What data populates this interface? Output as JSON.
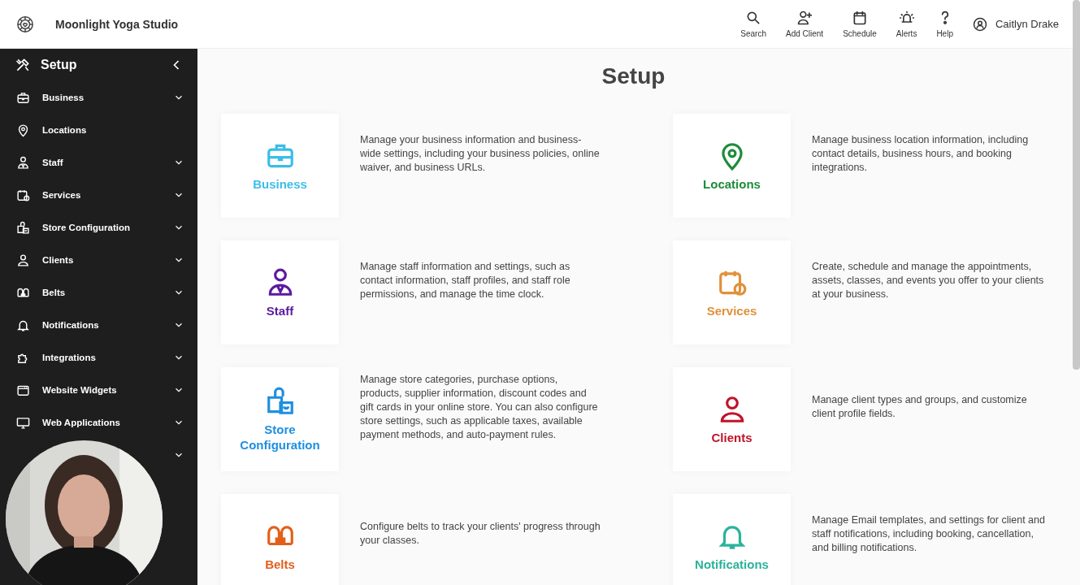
{
  "header": {
    "studio_name": "Moonlight Yoga Studio",
    "actions": [
      {
        "label": "Search"
      },
      {
        "label": "Add Client"
      },
      {
        "label": "Schedule"
      },
      {
        "label": "Alerts"
      },
      {
        "label": "Help"
      }
    ],
    "user_name": "Caitlyn Drake"
  },
  "sidebar": {
    "title": "Setup",
    "items": [
      {
        "label": "Business",
        "expandable": true
      },
      {
        "label": "Locations",
        "expandable": false
      },
      {
        "label": "Staff",
        "expandable": true
      },
      {
        "label": "Services",
        "expandable": true
      },
      {
        "label": "Store Configuration",
        "expandable": true
      },
      {
        "label": "Clients",
        "expandable": true
      },
      {
        "label": "Belts",
        "expandable": true
      },
      {
        "label": "Notifications",
        "expandable": true
      },
      {
        "label": "Integrations",
        "expandable": true
      },
      {
        "label": "Website Widgets",
        "expandable": true
      },
      {
        "label": "Web Applications",
        "expandable": true
      },
      {
        "expandable": true
      }
    ]
  },
  "page_title": "Setup",
  "cards": [
    {
      "title": "Business",
      "color": "#3bbde8",
      "description": "Manage your business information and business-wide settings, including your business policies, online waiver, and business URLs."
    },
    {
      "title": "Locations",
      "color": "#1e8c3a",
      "description": "Manage business location information, including contact details, business hours, and booking integrations."
    },
    {
      "title": "Staff",
      "color": "#5b1a9e",
      "description": "Manage staff information and settings, such as contact information, staff profiles, and staff role permissions, and manage the time clock."
    },
    {
      "title": "Services",
      "color": "#e0913a",
      "description": "Create, schedule and manage the appointments, assets, classes, and events you offer to your clients at your business."
    },
    {
      "title": "Store Configuration",
      "color": "#1e8fe0",
      "description": "Manage store categories, purchase options, products, supplier information, discount codes and gift cards in your online store. You can also configure store settings, such as applicable taxes, available payment methods, and auto-payment rules."
    },
    {
      "title": "Clients",
      "color": "#c0132a",
      "description": "Manage client types and groups, and customize client profile fields."
    },
    {
      "title": "Belts",
      "color": "#e35f1a",
      "description": "Configure belts to track your clients' progress through your classes."
    },
    {
      "title": "Notifications",
      "color": "#2ab39a",
      "description": "Manage Email templates, and settings for client and staff notifications, including booking, cancellation, and billing notifications."
    }
  ]
}
